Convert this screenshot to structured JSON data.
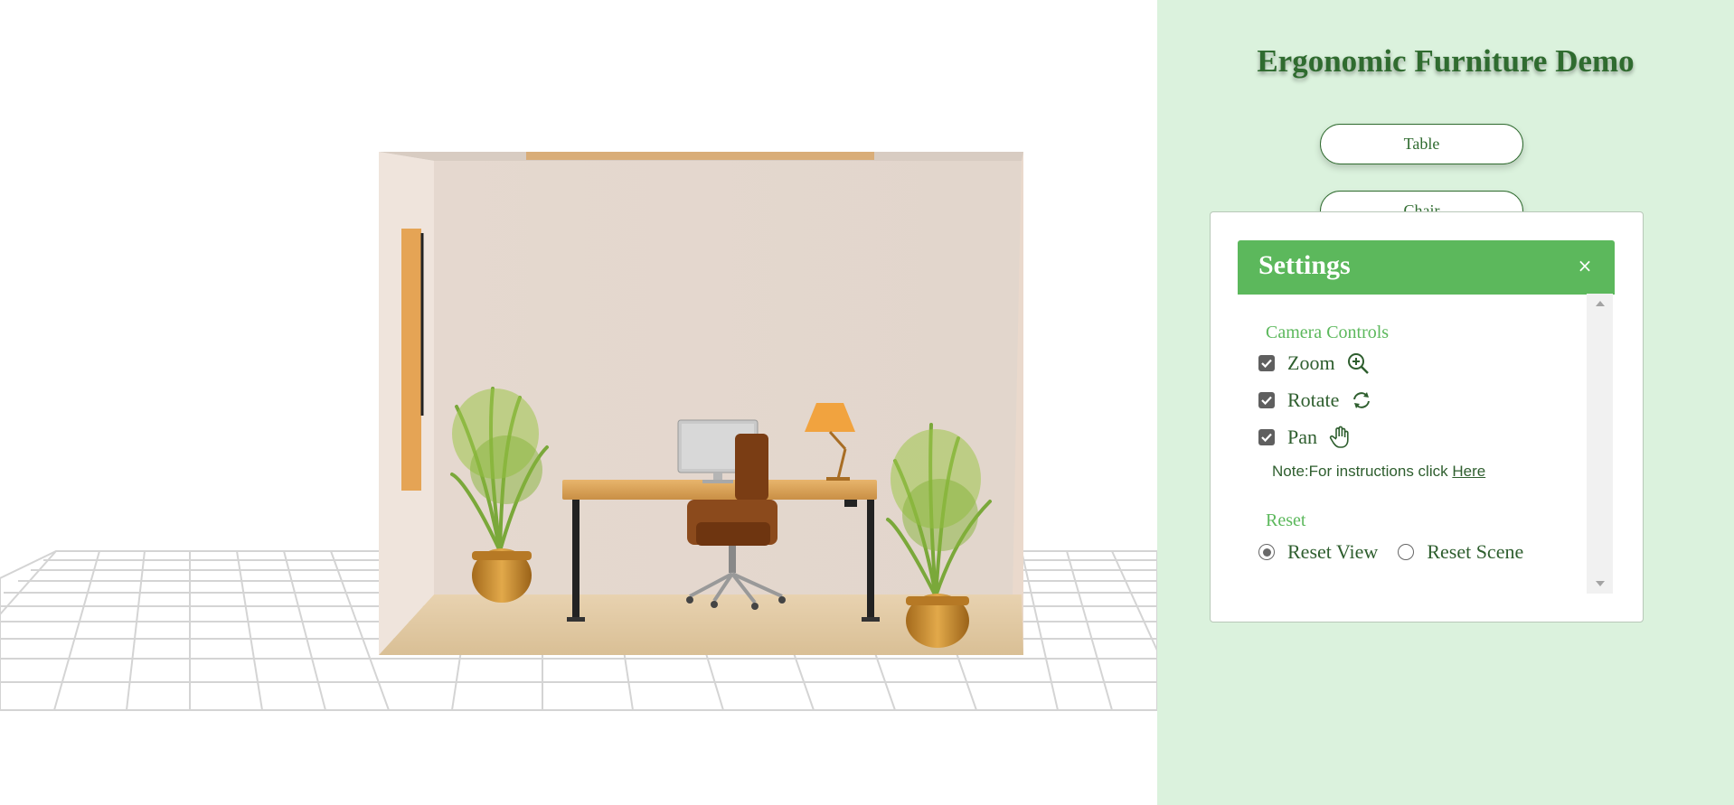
{
  "app": {
    "title": "Ergonomic Furniture Demo"
  },
  "models": {
    "table_label": "Table",
    "chair_label": "Chair"
  },
  "settings": {
    "title": "Settings",
    "close_icon": "×",
    "camera": {
      "title": "Camera Controls",
      "options": [
        {
          "label": "Zoom",
          "checked": true,
          "icon": "zoom-in-icon"
        },
        {
          "label": "Rotate",
          "checked": true,
          "icon": "rotate-icon"
        },
        {
          "label": "Pan",
          "checked": true,
          "icon": "hand-pan-icon"
        }
      ],
      "note_prefix": "Note:For instructions click ",
      "note_link": "Here"
    },
    "reset": {
      "title": "Reset",
      "options": [
        {
          "label": "Reset View",
          "selected": true
        },
        {
          "label": "Reset Scene",
          "selected": false
        }
      ]
    }
  },
  "colors": {
    "panel_bg": "#dbf2dd",
    "accent_green": "#5cb85c",
    "dark_green": "#2f6b2f"
  }
}
